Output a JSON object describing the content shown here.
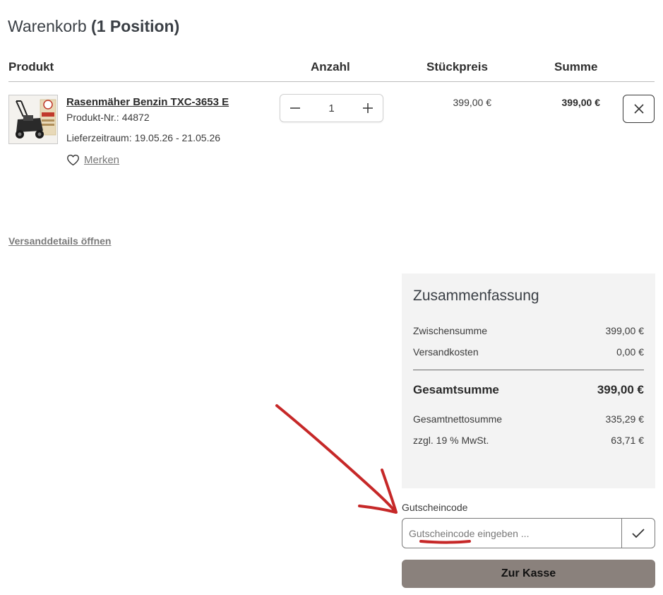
{
  "cart": {
    "title": "Warenkorb",
    "count_label": "(1 Position)"
  },
  "columns": {
    "product": "Produkt",
    "quantity": "Anzahl",
    "unit_price": "Stückpreis",
    "total": "Summe"
  },
  "item": {
    "name": "Rasenmäher Benzin TXC-3653 E",
    "number_label": "Produkt-Nr.:",
    "number": "44872",
    "delivery_label": "Lieferzeitraum:",
    "delivery": "19.05.26 - 21.05.26",
    "wishlist_label": "Merken",
    "quantity": "1",
    "unit_price": "399,00 €",
    "total": "399,00 €"
  },
  "shipping_link": "Versanddetails öffnen",
  "summary": {
    "title": "Zusammenfassung",
    "subtotal_label": "Zwischensumme",
    "subtotal": "399,00 €",
    "shipping_label": "Versandkosten",
    "shipping": "0,00 €",
    "total_label": "Gesamtsumme",
    "total": "399,00 €",
    "net_label": "Gesamtnettosumme",
    "net": "335,29 €",
    "vat_label": "zzgl. 19 % MwSt.",
    "vat": "63,71 €"
  },
  "coupon": {
    "label": "Gutscheincode",
    "placeholder": "Gutscheincode eingeben ..."
  },
  "checkout_label": "Zur Kasse",
  "colors": {
    "checkout_bg": "#8a817c",
    "summary_bg": "#f3f3f3",
    "annotation": "#c62828"
  }
}
